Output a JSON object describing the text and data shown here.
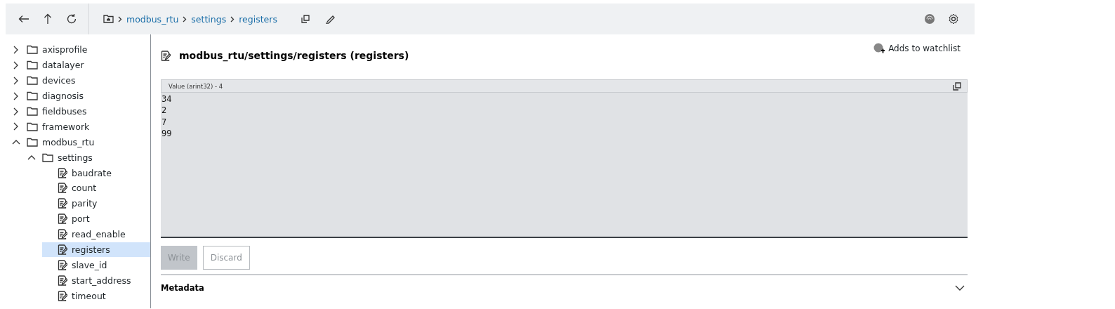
{
  "toolbar": {
    "breadcrumb": [
      "modbus_rtu",
      "settings",
      "registers"
    ]
  },
  "tree": [
    {
      "label": "axisprofile",
      "kind": "folder",
      "expanded": false
    },
    {
      "label": "datalayer",
      "kind": "folder",
      "expanded": false
    },
    {
      "label": "devices",
      "kind": "folder",
      "expanded": false
    },
    {
      "label": "diagnosis",
      "kind": "folder",
      "expanded": false
    },
    {
      "label": "fieldbuses",
      "kind": "folder",
      "expanded": false
    },
    {
      "label": "framework",
      "kind": "folder",
      "expanded": false
    },
    {
      "label": "modbus_rtu",
      "kind": "folder",
      "expanded": true,
      "children": [
        {
          "label": "settings",
          "kind": "folder",
          "expanded": true,
          "children": [
            {
              "label": "baudrate",
              "kind": "node",
              "selected": false
            },
            {
              "label": "count",
              "kind": "node",
              "selected": false
            },
            {
              "label": "parity",
              "kind": "node",
              "selected": false
            },
            {
              "label": "port",
              "kind": "node",
              "selected": false
            },
            {
              "label": "read_enable",
              "kind": "node",
              "selected": false
            },
            {
              "label": "registers",
              "kind": "node",
              "selected": true
            },
            {
              "label": "slave_id",
              "kind": "node",
              "selected": false
            },
            {
              "label": "start_address",
              "kind": "node",
              "selected": false
            },
            {
              "label": "timeout",
              "kind": "node",
              "selected": false
            }
          ]
        }
      ]
    }
  ],
  "detail": {
    "title": "modbus_rtu/settings/registers (registers)",
    "watchlist": "Adds to watchlist",
    "value": {
      "label": "Value (arint32) - 4",
      "lines": [
        "34",
        "2",
        "7",
        "99"
      ]
    },
    "buttons": [
      {
        "label": "Write",
        "kind": "primary",
        "disabled": true
      },
      {
        "label": "Discard",
        "kind": "secondary",
        "disabled": true
      }
    ],
    "metadata": {
      "label": "Metadata",
      "expanded": false
    }
  }
}
